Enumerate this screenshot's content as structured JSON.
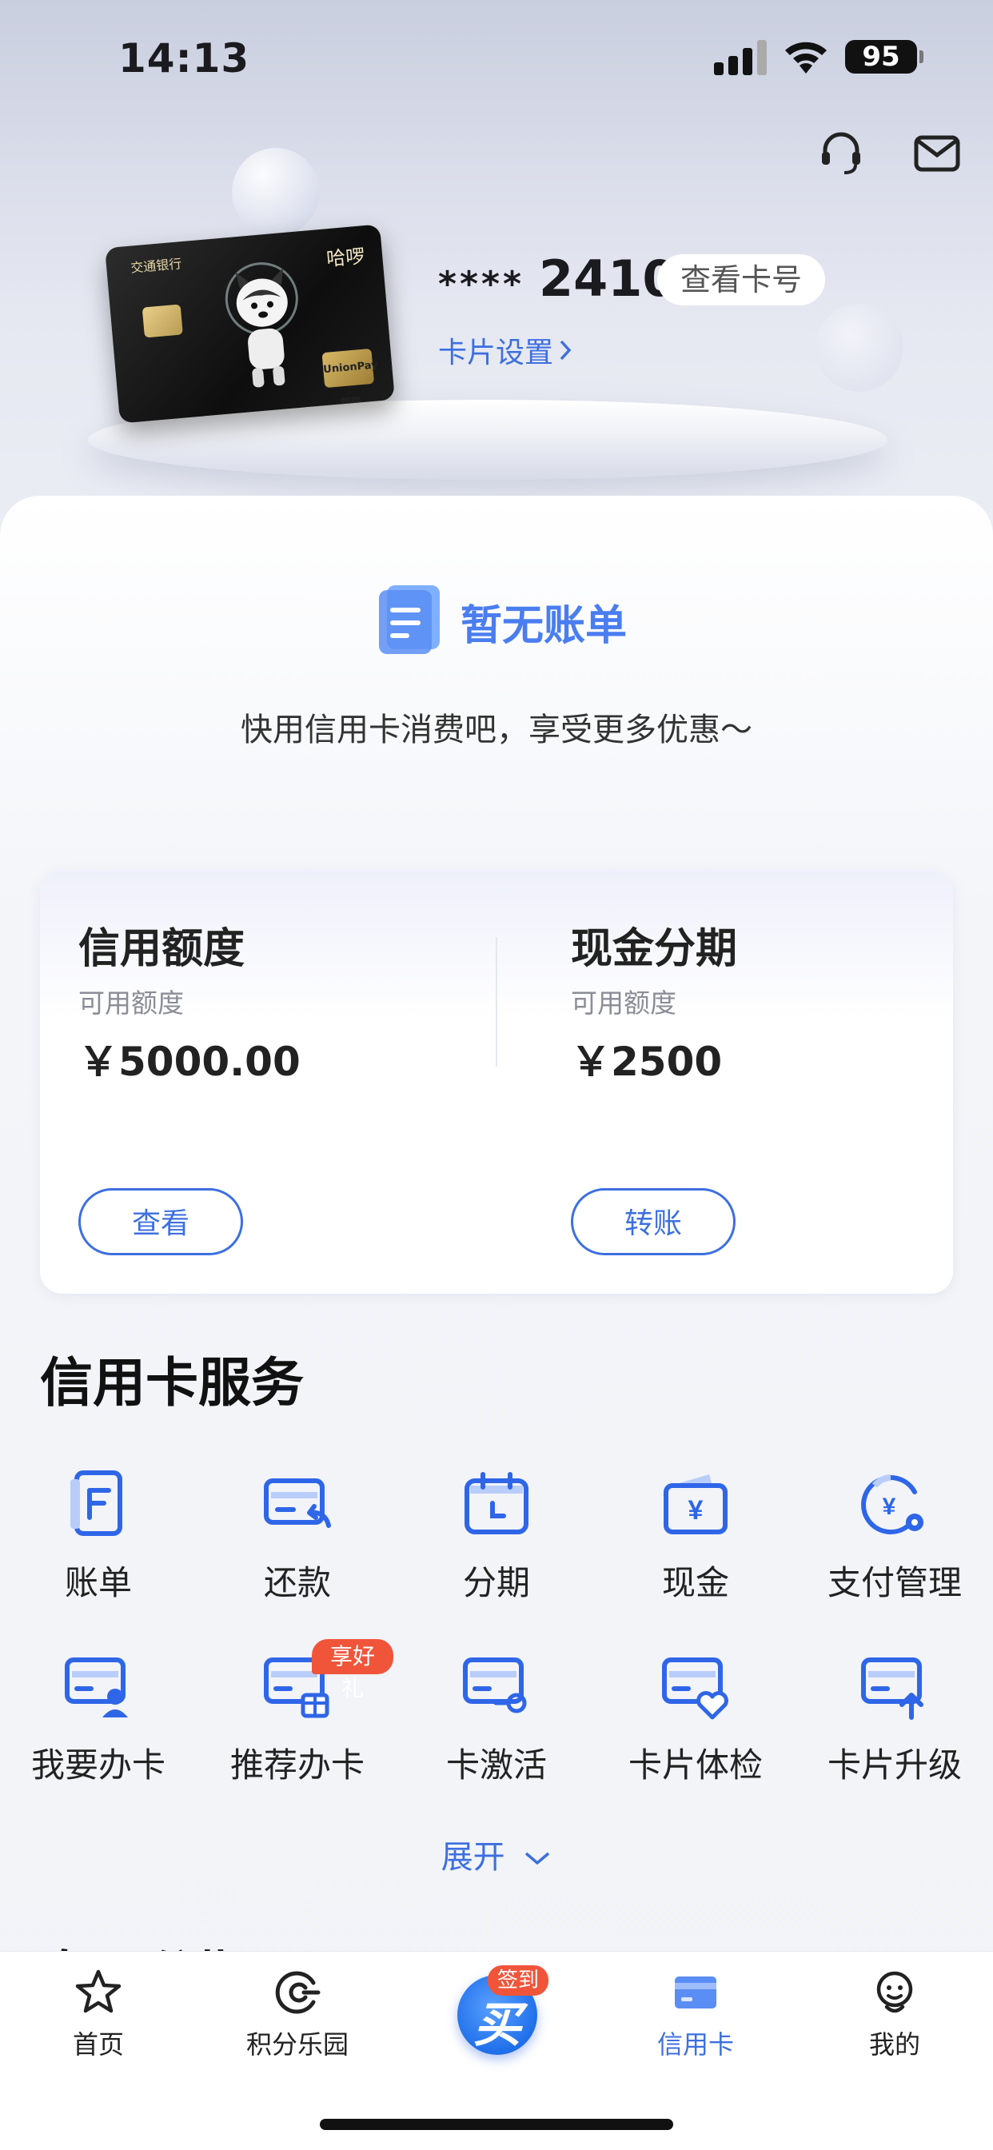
{
  "status_bar": {
    "time": "14:13",
    "battery": "95"
  },
  "card": {
    "masked_prefix": "****",
    "last4": "2410",
    "view_card_number": "查看卡号",
    "settings_link": "卡片设置",
    "image_texts": {
      "card_label": "哈啰",
      "network": "UnionPay 银联"
    }
  },
  "bill": {
    "title": "暂无账单",
    "description": "快用信用卡消费吧，享受更多优惠～"
  },
  "credit": {
    "title": "信用额度",
    "sub_label": "可用额度",
    "amount": "￥5000.00",
    "button": "查看"
  },
  "cash": {
    "title": "现金分期",
    "sub_label": "可用额度",
    "amount": "￥2500",
    "button": "转账"
  },
  "services": {
    "title": "信用卡服务",
    "items": [
      {
        "label": "账单",
        "icon": "bill-icon"
      },
      {
        "label": "还款",
        "icon": "repay-icon"
      },
      {
        "label": "分期",
        "icon": "calendar-icon"
      },
      {
        "label": "现金",
        "icon": "wallet-icon"
      },
      {
        "label": "支付管理",
        "icon": "payment-settings-icon"
      },
      {
        "label": "我要办卡",
        "icon": "apply-card-icon"
      },
      {
        "label": "推荐办卡",
        "icon": "recommend-card-icon",
        "badge": "享好礼"
      },
      {
        "label": "卡激活",
        "icon": "activate-card-icon"
      },
      {
        "label": "卡片体检",
        "icon": "card-checkup-icon"
      },
      {
        "label": "卡片升级",
        "icon": "card-upgrade-icon"
      }
    ],
    "expand_label": "展开"
  },
  "next_section_peek": "专项分期",
  "tab_bar": {
    "items": [
      {
        "label": "首页",
        "icon": "star-icon"
      },
      {
        "label": "积分乐园",
        "icon": "points-icon"
      },
      {
        "label": "",
        "icon": "checkin-icon",
        "badge": "签到"
      },
      {
        "label": "信用卡",
        "icon": "credit-card-icon",
        "active": true
      },
      {
        "label": "我的",
        "icon": "profile-icon"
      }
    ]
  },
  "colors": {
    "accent": "#3d6fe0",
    "badge": "#f0553a"
  }
}
